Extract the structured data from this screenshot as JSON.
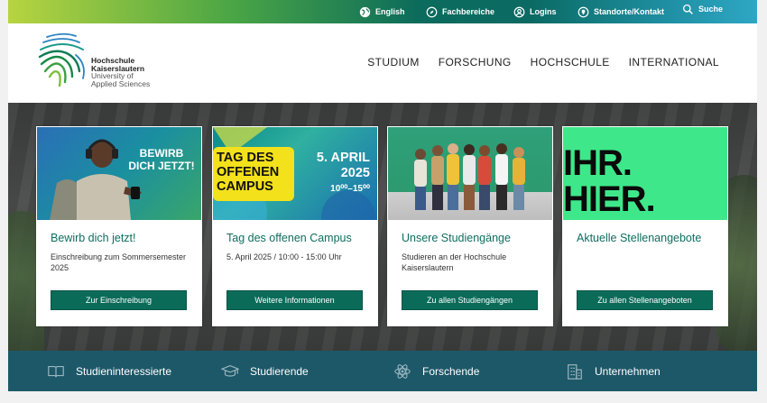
{
  "topbar": {
    "english": "English",
    "fachbereiche": "Fachbereiche",
    "logins": "Logins",
    "standorte": "Standorte/Kontakt",
    "suche": "Suche"
  },
  "logo": {
    "line1": "Hochschule",
    "line2": "Kaiserslautern",
    "line3": "University of",
    "line4": "Applied Sciences"
  },
  "nav": {
    "studium": "STUDIUM",
    "forschung": "FORSCHUNG",
    "hochschule": "HOCHSCHULE",
    "international": "INTERNATIONAL"
  },
  "cards": [
    {
      "image_text": [
        "BEWIRB",
        "DICH JETZT!"
      ],
      "title": "Bewirb dich jetzt!",
      "text": "Einschreibung zum Sommersemester 2025",
      "button": "Zur Einschreibung"
    },
    {
      "image_text": [
        "TAG DES",
        "OFFENEN",
        "CAMPUS",
        "5. APRIL",
        "2025",
        "10⁰⁰–15⁰⁰"
      ],
      "title": "Tag des offenen Campus",
      "text": "5. April 2025 / 10:00 - 15:00 Uhr",
      "button": "Weitere Informationen"
    },
    {
      "title": "Unsere Studiengänge",
      "text": "Studieren an der Hochschule Kaiserslautern",
      "button": "Zu allen Studiengängen"
    },
    {
      "image_text": [
        "IHR.",
        "HIER."
      ],
      "title": "Aktuelle Stellenangebote",
      "text": "",
      "button": "Zu allen Stellenangeboten"
    }
  ],
  "band": {
    "studieninteressierte": "Studieninteressierte",
    "studierende": "Studierende",
    "forschende": "Forschende",
    "unternehmen": "Unternehmen"
  },
  "colors": {
    "primary_green": "#0b6b59",
    "title_green": "#0e6e5f",
    "band_blue": "#1d5868",
    "stellen_green": "#3ee88a"
  }
}
